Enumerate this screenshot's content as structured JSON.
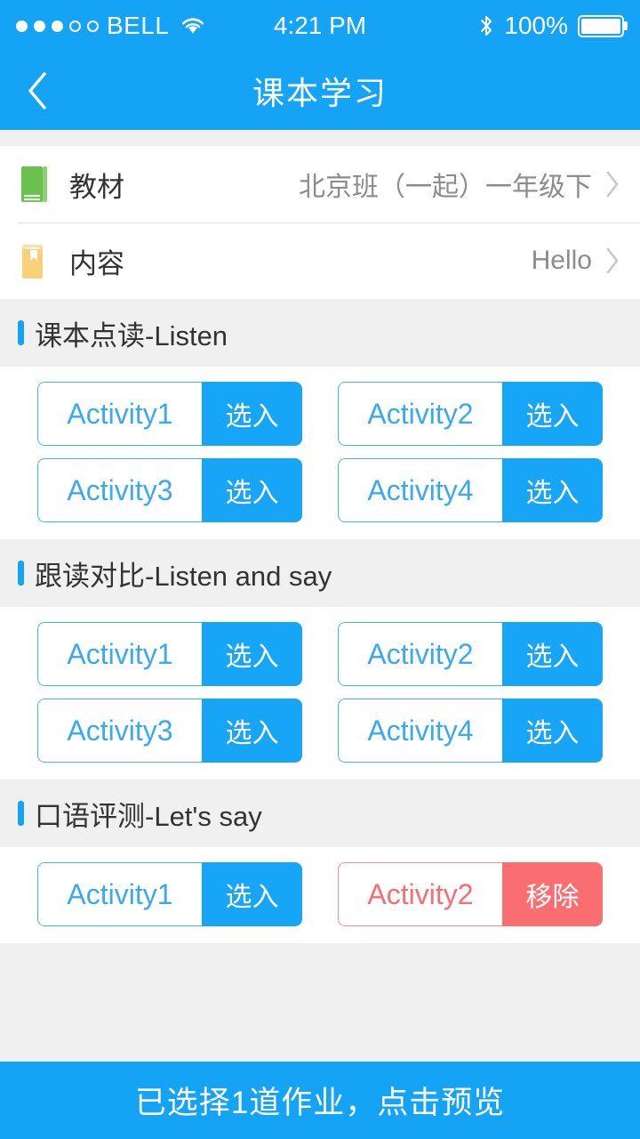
{
  "status_bar": {
    "carrier": "BELL",
    "signal_dots_filled": 3,
    "signal_dots_total": 5,
    "wifi_icon": "wifi-icon",
    "time": "4:21 PM",
    "bluetooth_icon": "bluetooth-icon",
    "battery_percent": "100%",
    "battery_icon": "battery-full-icon"
  },
  "nav": {
    "back_icon": "chevron-left-icon",
    "title": "课本学习"
  },
  "selectors": [
    {
      "icon": "green-book-icon",
      "label": "教材",
      "value": "北京班（一起）一年级下",
      "chevron": "chevron-right-icon"
    },
    {
      "icon": "yellow-book-icon",
      "label": "内容",
      "value": "Hello",
      "chevron": "chevron-right-icon"
    }
  ],
  "sections": [
    {
      "title": "课本点读-Listen",
      "activities": [
        {
          "name": "Activity1",
          "action": "选入",
          "state": "add"
        },
        {
          "name": "Activity2",
          "action": "选入",
          "state": "add"
        },
        {
          "name": "Activity3",
          "action": "选入",
          "state": "add"
        },
        {
          "name": "Activity4",
          "action": "选入",
          "state": "add"
        }
      ]
    },
    {
      "title": "跟读对比-Listen and say",
      "activities": [
        {
          "name": "Activity1",
          "action": "选入",
          "state": "add"
        },
        {
          "name": "Activity2",
          "action": "选入",
          "state": "add"
        },
        {
          "name": "Activity3",
          "action": "选入",
          "state": "add"
        },
        {
          "name": "Activity4",
          "action": "选入",
          "state": "add"
        }
      ]
    },
    {
      "title": "口语评测-Let's say",
      "activities": [
        {
          "name": "Activity1",
          "action": "选入",
          "state": "add"
        },
        {
          "name": "Activity2",
          "action": "移除",
          "state": "remove"
        }
      ]
    }
  ],
  "bottom_bar": {
    "label": "已选择1道作业，点击预览",
    "selected_count": 1
  },
  "colors": {
    "brand_blue": "#14a3f5",
    "action_blue": "#16a5f7",
    "remove_red": "#fa6e72",
    "page_bg": "#f0f0f0",
    "card_bg": "#ffffff",
    "text_primary": "#333333",
    "text_secondary": "#8c8c8c",
    "book_green": "#6bc14f",
    "book_yellow": "#fbd178"
  }
}
